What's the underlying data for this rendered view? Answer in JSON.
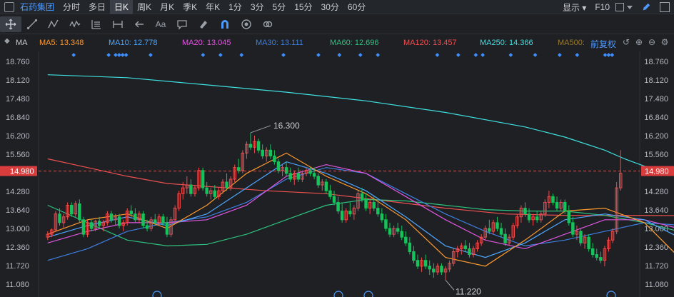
{
  "header": {
    "stock_name": "石药集团",
    "periods": [
      "分时",
      "多日",
      "日K",
      "周K",
      "月K",
      "季K",
      "年K",
      "1分",
      "3分",
      "5分",
      "15分",
      "30分",
      "60分"
    ],
    "active_period": "日K",
    "display_label": "显示",
    "f10_label": "F10"
  },
  "toolbar": {
    "items": [
      "crosshair-icon",
      "line-tool-icon",
      "zigzag-tool-icon",
      "wave-tool-icon",
      "fib-tool-icon",
      "measure-tool-icon",
      "arrow-tool-icon",
      "text-tool-icon",
      "note-tool-icon",
      "eraser-icon",
      "magnet-icon",
      "eye-icon",
      "link-icon"
    ],
    "text_tool_label": "Aa"
  },
  "legend": {
    "title": "MA",
    "adjust_label": "前复权",
    "items": [
      {
        "text": "MA5: 13.348",
        "color": "#ff9a2e"
      },
      {
        "text": "MA10: 12.778",
        "color": "#4da6ff"
      },
      {
        "text": "MA20: 13.045",
        "color": "#e056e0"
      },
      {
        "text": "MA30: 13.111",
        "color": "#3f7fe0"
      },
      {
        "text": "MA60: 12.696",
        "color": "#2ec27e"
      },
      {
        "text": "MA120: 13.457",
        "color": "#f05050"
      },
      {
        "text": "MA250: 14.366",
        "color": "#3fe0e0"
      },
      {
        "text": "MA500:",
        "color": "#9a7a30"
      }
    ]
  },
  "chart_data": {
    "type": "candlestick",
    "y_ticks": [
      "18.760",
      "18.120",
      "17.480",
      "16.840",
      "16.200",
      "15.560",
      "14.920",
      "14.280",
      "13.640",
      "13.000",
      "12.360",
      "11.720",
      "11.080"
    ],
    "current_price": "14.980",
    "ylim": [
      11.08,
      18.76
    ],
    "annotations": [
      {
        "text": "16.300",
        "value": 16.3
      },
      {
        "text": "11.220",
        "value": 11.22
      }
    ],
    "colors": {
      "up": "#f04a4a",
      "down": "#16c25a"
    },
    "candles": [
      [
        12.7,
        12.9,
        12.6,
        12.8
      ],
      [
        12.8,
        13.0,
        12.7,
        12.95
      ],
      [
        12.95,
        13.6,
        12.9,
        13.5
      ],
      [
        13.5,
        13.7,
        13.1,
        13.2
      ],
      [
        13.2,
        13.5,
        13.0,
        13.4
      ],
      [
        13.4,
        13.9,
        13.3,
        13.8
      ],
      [
        13.8,
        13.9,
        13.4,
        13.5
      ],
      [
        13.5,
        13.95,
        13.4,
        13.85
      ],
      [
        13.85,
        14.0,
        13.2,
        13.3
      ],
      [
        13.3,
        13.4,
        12.7,
        12.8
      ],
      [
        12.8,
        13.3,
        12.7,
        13.2
      ],
      [
        13.2,
        13.3,
        12.9,
        13.0
      ],
      [
        13.0,
        13.3,
        12.9,
        13.25
      ],
      [
        13.25,
        13.4,
        13.0,
        13.1
      ],
      [
        13.1,
        13.3,
        12.9,
        13.2
      ],
      [
        13.2,
        13.6,
        13.1,
        13.5
      ],
      [
        13.5,
        13.6,
        13.2,
        13.3
      ],
      [
        13.3,
        13.5,
        13.1,
        13.4
      ],
      [
        13.4,
        13.5,
        13.0,
        13.1
      ],
      [
        13.1,
        13.3,
        12.9,
        13.2
      ],
      [
        13.2,
        13.7,
        13.1,
        13.6
      ],
      [
        13.6,
        13.8,
        13.4,
        13.5
      ],
      [
        13.5,
        13.7,
        13.2,
        13.3
      ],
      [
        13.3,
        13.6,
        13.2,
        13.5
      ],
      [
        13.5,
        13.6,
        13.0,
        13.1
      ],
      [
        13.1,
        13.3,
        12.9,
        13.0
      ],
      [
        13.0,
        13.4,
        12.9,
        13.3
      ],
      [
        13.3,
        13.5,
        13.1,
        13.2
      ],
      [
        13.2,
        13.5,
        13.1,
        13.4
      ],
      [
        13.4,
        13.5,
        13.1,
        13.2
      ],
      [
        13.2,
        13.4,
        12.7,
        12.8
      ],
      [
        12.8,
        13.4,
        12.7,
        13.3
      ],
      [
        13.3,
        13.8,
        13.2,
        13.7
      ],
      [
        13.7,
        14.3,
        13.6,
        14.2
      ],
      [
        14.2,
        14.6,
        14.0,
        14.4
      ],
      [
        14.4,
        14.8,
        14.2,
        14.5
      ],
      [
        14.5,
        14.7,
        14.1,
        14.2
      ],
      [
        14.2,
        14.5,
        14.1,
        14.4
      ],
      [
        14.4,
        15.1,
        14.3,
        15.0
      ],
      [
        15.0,
        15.1,
        14.3,
        14.4
      ],
      [
        14.4,
        14.6,
        14.1,
        14.2
      ],
      [
        14.2,
        14.4,
        14.0,
        14.3
      ],
      [
        14.3,
        14.5,
        14.0,
        14.1
      ],
      [
        14.1,
        14.4,
        14.0,
        14.3
      ],
      [
        14.3,
        14.7,
        14.2,
        14.6
      ],
      [
        14.6,
        14.9,
        14.3,
        14.4
      ],
      [
        14.4,
        14.8,
        14.3,
        14.7
      ],
      [
        14.7,
        15.2,
        14.6,
        15.1
      ],
      [
        15.1,
        15.4,
        14.9,
        15.0
      ],
      [
        15.0,
        15.7,
        14.9,
        15.6
      ],
      [
        15.6,
        16.0,
        15.4,
        15.9
      ],
      [
        15.9,
        16.3,
        15.7,
        15.8
      ],
      [
        15.8,
        16.2,
        15.6,
        16.0
      ],
      [
        16.0,
        16.1,
        15.6,
        15.7
      ],
      [
        15.7,
        15.9,
        15.4,
        15.5
      ],
      [
        15.5,
        15.8,
        15.3,
        15.7
      ],
      [
        15.7,
        15.9,
        15.4,
        15.5
      ],
      [
        15.5,
        15.7,
        15.2,
        15.3
      ],
      [
        15.3,
        15.4,
        14.9,
        15.0
      ],
      [
        15.0,
        15.2,
        14.8,
        15.1
      ],
      [
        15.1,
        15.3,
        14.8,
        14.9
      ],
      [
        14.9,
        15.1,
        14.6,
        14.7
      ],
      [
        14.7,
        15.0,
        14.5,
        14.9
      ],
      [
        14.9,
        15.1,
        14.6,
        14.7
      ],
      [
        14.7,
        15.0,
        14.6,
        14.9
      ],
      [
        14.9,
        15.1,
        14.8,
        15.0
      ],
      [
        15.0,
        15.1,
        14.8,
        14.9
      ],
      [
        14.9,
        15.1,
        14.7,
        14.8
      ],
      [
        14.8,
        14.9,
        14.4,
        14.5
      ],
      [
        14.5,
        14.7,
        14.3,
        14.6
      ],
      [
        14.6,
        14.7,
        14.2,
        14.3
      ],
      [
        14.3,
        14.5,
        14.0,
        14.1
      ],
      [
        14.1,
        14.3,
        13.8,
        13.9
      ],
      [
        13.9,
        14.1,
        13.5,
        13.6
      ],
      [
        13.6,
        13.9,
        13.2,
        13.3
      ],
      [
        13.3,
        13.7,
        13.2,
        13.6
      ],
      [
        13.6,
        13.9,
        13.4,
        13.5
      ],
      [
        13.5,
        13.8,
        13.3,
        13.7
      ],
      [
        13.7,
        14.3,
        13.6,
        14.2
      ],
      [
        14.2,
        14.4,
        13.9,
        14.0
      ],
      [
        14.0,
        14.2,
        13.6,
        13.7
      ],
      [
        13.7,
        14.0,
        13.5,
        13.9
      ],
      [
        13.9,
        14.1,
        13.6,
        13.7
      ],
      [
        13.7,
        13.9,
        13.4,
        13.5
      ],
      [
        13.5,
        13.7,
        13.2,
        13.3
      ],
      [
        13.3,
        13.5,
        12.9,
        13.0
      ],
      [
        13.0,
        13.2,
        12.7,
        12.8
      ],
      [
        12.8,
        13.1,
        12.7,
        13.0
      ],
      [
        13.0,
        13.2,
        12.8,
        12.9
      ],
      [
        12.9,
        13.1,
        12.6,
        12.7
      ],
      [
        12.7,
        12.9,
        12.4,
        12.5
      ],
      [
        12.5,
        12.7,
        12.1,
        12.2
      ],
      [
        12.2,
        12.4,
        11.8,
        11.9
      ],
      [
        11.9,
        12.1,
        11.6,
        11.7
      ],
      [
        11.7,
        12.0,
        11.5,
        11.9
      ],
      [
        11.9,
        12.1,
        11.6,
        11.7
      ],
      [
        11.7,
        11.9,
        11.4,
        11.6
      ],
      [
        11.6,
        11.8,
        11.3,
        11.5
      ],
      [
        11.5,
        11.8,
        11.4,
        11.7
      ],
      [
        11.7,
        11.8,
        11.4,
        11.5
      ],
      [
        11.5,
        11.7,
        11.22,
        11.6
      ],
      [
        11.6,
        11.9,
        11.5,
        11.8
      ],
      [
        11.8,
        12.3,
        11.7,
        12.2
      ],
      [
        12.2,
        12.4,
        12.0,
        12.3
      ],
      [
        12.3,
        12.5,
        12.1,
        12.4
      ],
      [
        12.4,
        12.6,
        12.2,
        12.3
      ],
      [
        12.3,
        12.5,
        12.0,
        12.1
      ],
      [
        12.1,
        12.4,
        12.0,
        12.3
      ],
      [
        12.3,
        12.6,
        12.2,
        12.5
      ],
      [
        12.5,
        12.8,
        12.4,
        12.7
      ],
      [
        12.7,
        13.1,
        12.6,
        13.0
      ],
      [
        13.0,
        13.3,
        12.8,
        12.9
      ],
      [
        12.9,
        13.3,
        12.8,
        13.2
      ],
      [
        13.2,
        13.4,
        12.9,
        13.0
      ],
      [
        13.0,
        13.2,
        12.7,
        12.8
      ],
      [
        12.8,
        13.0,
        12.4,
        12.5
      ],
      [
        12.5,
        12.8,
        12.4,
        12.7
      ],
      [
        12.7,
        13.2,
        12.6,
        13.1
      ],
      [
        13.1,
        13.5,
        13.0,
        13.4
      ],
      [
        13.4,
        13.8,
        13.2,
        13.7
      ],
      [
        13.7,
        13.9,
        13.4,
        13.5
      ],
      [
        13.5,
        13.7,
        13.2,
        13.3
      ],
      [
        13.3,
        13.5,
        13.1,
        13.4
      ],
      [
        13.4,
        13.6,
        13.2,
        13.3
      ],
      [
        13.3,
        13.6,
        13.2,
        13.5
      ],
      [
        13.5,
        14.0,
        13.4,
        13.9
      ],
      [
        13.9,
        14.3,
        13.7,
        14.1
      ],
      [
        14.1,
        14.2,
        13.8,
        13.9
      ],
      [
        13.9,
        14.1,
        13.6,
        13.7
      ],
      [
        13.7,
        14.0,
        13.6,
        13.9
      ],
      [
        13.9,
        14.0,
        13.5,
        13.6
      ],
      [
        13.6,
        13.8,
        13.1,
        13.2
      ],
      [
        13.2,
        13.4,
        12.7,
        12.8
      ],
      [
        12.8,
        13.1,
        12.6,
        12.9
      ],
      [
        12.9,
        13.0,
        12.4,
        12.5
      ],
      [
        12.5,
        12.8,
        12.3,
        12.7
      ],
      [
        12.7,
        12.8,
        12.2,
        12.3
      ],
      [
        12.3,
        12.5,
        12.0,
        12.1
      ],
      [
        12.1,
        12.3,
        11.9,
        12.0
      ],
      [
        12.0,
        12.2,
        11.8,
        11.9
      ],
      [
        11.9,
        12.4,
        11.7,
        12.3
      ],
      [
        12.3,
        12.7,
        12.2,
        12.6
      ],
      [
        12.6,
        13.0,
        12.5,
        12.9
      ],
      [
        12.9,
        14.6,
        12.8,
        14.4
      ],
      [
        14.4,
        15.7,
        14.3,
        14.9
      ]
    ],
    "ma_series": [
      {
        "name": "MA250",
        "color": "#3fe0e0",
        "values": [
          [
            0,
            18.3
          ],
          [
            20,
            18.2
          ],
          [
            40,
            17.95
          ],
          [
            60,
            17.7
          ],
          [
            80,
            17.4
          ],
          [
            100,
            17.0
          ],
          [
            120,
            16.5
          ],
          [
            130,
            16.15
          ],
          [
            140,
            15.7
          ],
          [
            145,
            15.4
          ],
          [
            150,
            15.15
          ],
          [
            155,
            14.95
          ],
          [
            164,
            14.7
          ]
        ]
      },
      {
        "name": "MA120",
        "color": "#f05050",
        "values": [
          [
            0,
            15.4
          ],
          [
            10,
            15.1
          ],
          [
            20,
            14.8
          ],
          [
            30,
            14.55
          ],
          [
            40,
            14.45
          ],
          [
            55,
            14.3
          ],
          [
            70,
            14.2
          ],
          [
            85,
            13.95
          ],
          [
            100,
            13.7
          ],
          [
            115,
            13.5
          ],
          [
            130,
            13.45
          ],
          [
            145,
            13.45
          ],
          [
            164,
            13.44
          ]
        ]
      },
      {
        "name": "MA60",
        "color": "#2ec27e",
        "values": [
          [
            0,
            13.8
          ],
          [
            10,
            13.2
          ],
          [
            20,
            12.6
          ],
          [
            30,
            12.4
          ],
          [
            40,
            12.45
          ],
          [
            50,
            12.8
          ],
          [
            60,
            13.3
          ],
          [
            70,
            13.8
          ],
          [
            80,
            14.0
          ],
          [
            90,
            13.95
          ],
          [
            100,
            13.8
          ],
          [
            110,
            13.65
          ],
          [
            120,
            13.6
          ],
          [
            130,
            13.6
          ],
          [
            140,
            13.45
          ],
          [
            150,
            13.2
          ],
          [
            160,
            12.85
          ],
          [
            164,
            12.7
          ]
        ]
      },
      {
        "name": "MA30",
        "color": "#3f7fe0",
        "values": [
          [
            0,
            11.9
          ],
          [
            10,
            12.3
          ],
          [
            20,
            12.9
          ],
          [
            30,
            13.2
          ],
          [
            40,
            13.4
          ],
          [
            50,
            13.9
          ],
          [
            60,
            14.7
          ],
          [
            70,
            15.1
          ],
          [
            80,
            14.9
          ],
          [
            90,
            14.2
          ],
          [
            100,
            13.5
          ],
          [
            110,
            12.9
          ],
          [
            120,
            12.4
          ],
          [
            130,
            12.6
          ],
          [
            140,
            12.9
          ],
          [
            150,
            13.2
          ],
          [
            160,
            13.1
          ],
          [
            164,
            13.11
          ]
        ]
      },
      {
        "name": "MA20",
        "color": "#e056e0",
        "values": [
          [
            0,
            12.5
          ],
          [
            10,
            12.9
          ],
          [
            20,
            13.2
          ],
          [
            30,
            13.2
          ],
          [
            40,
            13.3
          ],
          [
            50,
            13.8
          ],
          [
            60,
            14.8
          ],
          [
            70,
            15.2
          ],
          [
            80,
            14.9
          ],
          [
            90,
            14.1
          ],
          [
            100,
            13.3
          ],
          [
            110,
            12.6
          ],
          [
            120,
            12.3
          ],
          [
            130,
            12.8
          ],
          [
            140,
            13.3
          ],
          [
            150,
            13.3
          ],
          [
            160,
            12.95
          ],
          [
            164,
            13.05
          ]
        ]
      },
      {
        "name": "MA10",
        "color": "#4da6ff",
        "values": [
          [
            0,
            12.7
          ],
          [
            10,
            13.1
          ],
          [
            20,
            13.4
          ],
          [
            30,
            13.1
          ],
          [
            40,
            13.5
          ],
          [
            50,
            14.4
          ],
          [
            60,
            15.3
          ],
          [
            70,
            14.9
          ],
          [
            80,
            14.3
          ],
          [
            90,
            13.4
          ],
          [
            100,
            12.4
          ],
          [
            110,
            12.0
          ],
          [
            120,
            12.5
          ],
          [
            130,
            13.3
          ],
          [
            140,
            13.5
          ],
          [
            150,
            13.3
          ],
          [
            160,
            12.6
          ],
          [
            164,
            12.78
          ]
        ]
      },
      {
        "name": "MA5",
        "color": "#ff9a2e",
        "values": [
          [
            0,
            12.8
          ],
          [
            10,
            13.3
          ],
          [
            20,
            13.5
          ],
          [
            30,
            13.0
          ],
          [
            40,
            13.8
          ],
          [
            50,
            14.9
          ],
          [
            60,
            15.6
          ],
          [
            70,
            14.8
          ],
          [
            80,
            14.2
          ],
          [
            90,
            13.3
          ],
          [
            100,
            12.0
          ],
          [
            110,
            11.7
          ],
          [
            120,
            12.6
          ],
          [
            130,
            13.6
          ],
          [
            140,
            13.7
          ],
          [
            150,
            13.2
          ],
          [
            158,
            12.1
          ],
          [
            164,
            13.35
          ]
        ]
      }
    ]
  }
}
